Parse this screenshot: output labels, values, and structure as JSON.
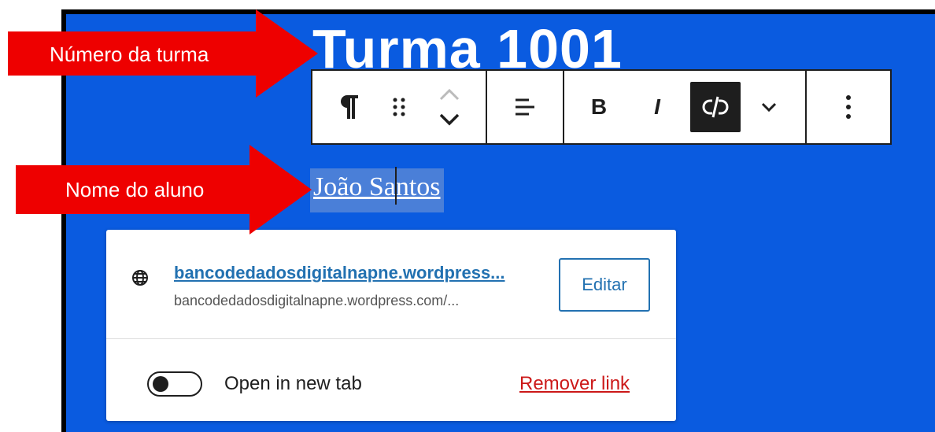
{
  "heading": {
    "text": "Turma 1001"
  },
  "toolbar": {
    "paragraph_icon": "paragraph-icon",
    "drag_icon": "drag-handle-icon",
    "move_icon": "move-up-down-icon",
    "align_icon": "align-left-icon",
    "bold_label": "B",
    "italic_label": "I",
    "unlink_icon": "unlink-icon",
    "more_format_icon": "chevron-down-icon",
    "options_icon": "more-vertical-icon"
  },
  "student_name": {
    "before_caret": "João Sa",
    "after_caret": "ntos"
  },
  "link_popover": {
    "title": "bancodedadosdigitalnapne.wordpress...",
    "url": "bancodedadosdigitalnapne.wordpress.com/...",
    "edit_label": "Editar",
    "open_new_tab_label": "Open in new tab",
    "remove_link_label": "Remover link",
    "open_new_tab_checked": false
  },
  "annotations": {
    "class_number_label": "Número da turma",
    "student_name_label": "Nome do aluno"
  },
  "colors": {
    "canvas": "#0a5be0",
    "arrow": "#ee0000",
    "link": "#2271b1",
    "remove": "#cc1818"
  }
}
